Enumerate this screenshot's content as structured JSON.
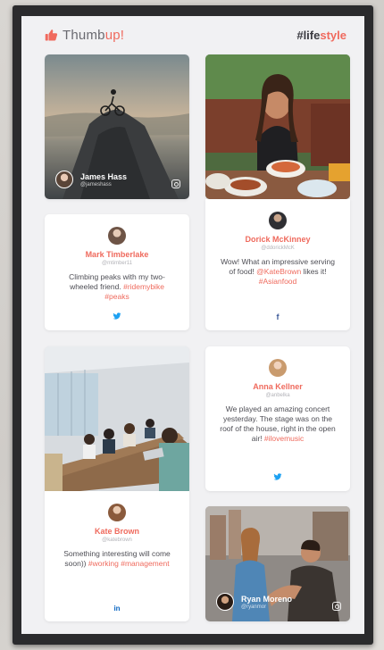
{
  "header": {
    "logo_text": "Thumb",
    "logo_accent": "up!",
    "hashtag_prefix": "#life",
    "hashtag_accent": "style"
  },
  "cards": {
    "james": {
      "name": "James Hass",
      "handle": "@jameshass",
      "network": "instagram-icon"
    },
    "mark": {
      "name": "Mark Timberlake",
      "handle": "@mtimber11",
      "text": "Climbing peaks with my two-wheeled friend.",
      "tags": "#ridemybike #peaks",
      "network": "twitter-icon"
    },
    "dorick": {
      "name": "Dorick McKinney",
      "handle": "@ddorickMcK",
      "text": "Wow! What an impressive serving of food!",
      "mention": "@KateBrown",
      "text2": "likes it!",
      "tags": "#Asianfood",
      "network": "facebook-icon"
    },
    "anna": {
      "name": "Anna Kellner",
      "handle": "@anbelka",
      "text": "We played an amazing concert yesterday. The stage was on the roof of the house, right in the open air!",
      "tags": "#ilovemusic",
      "network": "twitter-icon"
    },
    "kate": {
      "name": "Kate Brown",
      "handle": "@katebrown",
      "text": "Something interesting will come soon))",
      "tags": "#working #management",
      "network": "linkedin-icon"
    },
    "ryan": {
      "name": "Ryan Moreno",
      "handle": "@ryanmor",
      "network": "instagram-icon"
    }
  },
  "social_glyphs": {
    "twitter": "🐦",
    "facebook": "f",
    "linkedin": "in"
  },
  "colors": {
    "accent": "#f06a5e",
    "background": "#f1f1f3",
    "bezel": "#2b2b2d"
  }
}
